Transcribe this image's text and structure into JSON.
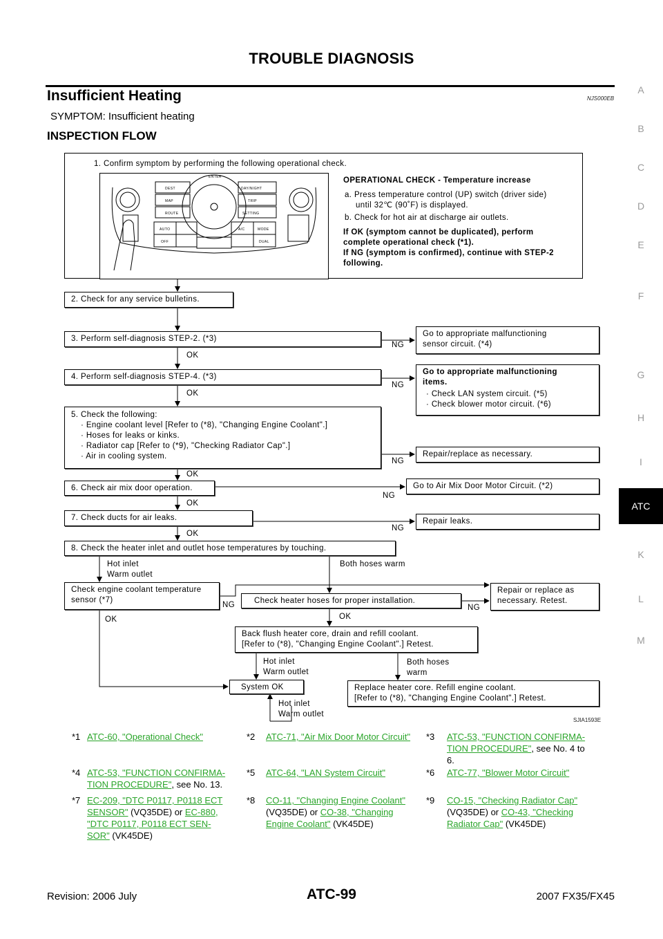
{
  "header": {
    "title": "TROUBLE DIAGNOSIS"
  },
  "section": {
    "title": "Insufficient Heating",
    "code": "NJS000EB",
    "symptom": "SYMPTOM: Insufficient heating",
    "subheading": "INSPECTION FLOW"
  },
  "side_index": {
    "items": [
      "A",
      "B",
      "C",
      "D",
      "E",
      "F",
      "G",
      "H",
      "I",
      "ATC",
      "K",
      "L",
      "M"
    ],
    "active": "ATC"
  },
  "flow": {
    "step1": {
      "title": "1. Confirm symptom by performing the following operational check.",
      "check_title": "OPERATIONAL CHECK - Temperature increase",
      "a_line1": "a. Press temperature control (UP) switch (driver side)",
      "a_line2": "until 32℃  (90˚F) is displayed.",
      "b": "b. Check for hot air at discharge air outlets.",
      "result1": "If OK (symptom cannot be duplicated), perform",
      "result2": "complete operational check (*1).",
      "result3": "If NG (symptom is confirmed), continue with STEP-2",
      "result4": "following.",
      "panel": {
        "buttons": [
          "DEST",
          "MAP",
          "ROUTE",
          "DAY/NIGHT",
          "TRIP",
          "SETTING",
          "AUTO",
          "OFF",
          "A/C",
          "MODE",
          "DUAL",
          "ENTER"
        ]
      }
    },
    "step2": "2. Check for any service bulletins.",
    "step3": "3. Perform self-diagnosis STEP-2. (*3)",
    "step3_ng": [
      "Go to appropriate malfunctioning",
      "sensor circuit. (*4)"
    ],
    "step4": "4. Perform self-diagnosis STEP-4. (*3)",
    "step4_ng_title": [
      "Go to appropriate malfunctioning",
      "items."
    ],
    "step4_ng_items": [
      "· Check LAN system circuit. (*5)",
      "· Check blower motor circuit. (*6)"
    ],
    "step5_title": "5.  Check the following:",
    "step5_items": [
      "· Engine coolant level [Refer to (*8), \"Changing Engine Coolant\".]",
      "· Hoses for leaks or kinks.",
      "· Radiator cap [Refer to (*9), \"Checking Radiator Cap\".]",
      "· Air in cooling system."
    ],
    "step5_ng": "Repair/replace as necessary.",
    "step6": "6. Check air mix door operation.",
    "step6_ng": "Go to Air Mix Door Motor Circuit. (*2)",
    "step7": "7. Check ducts for air leaks.",
    "step7_ng": "Repair leaks.",
    "step8": "8. Check the heater inlet and outlet hose temperatures by touching.",
    "hot_inlet": "Hot inlet",
    "warm_outlet": "Warm outlet",
    "both_warm": "Both hoses warm",
    "both_hoses": "Both hoses",
    "warm": "warm",
    "ect_sensor": [
      "Check engine coolant temperature",
      "sensor (*7)"
    ],
    "heater_hoses": "Check heater hoses for proper installation.",
    "repair_replace": [
      "Repair or replace as",
      "necessary. Retest."
    ],
    "back_flush": [
      "Back flush heater core, drain and refill coolant.",
      "[Refer to (*8), \"Changing Engine Coolant\".] Retest."
    ],
    "system_ok": "System OK",
    "replace_core": [
      "Replace heater core. Refill engine coolant.",
      "[Refer to (*8), \"Changing Engine Coolant\".] Retest."
    ],
    "ok": "OK",
    "ng": "NG",
    "figure_id": "SJIA1593E"
  },
  "references": [
    {
      "num": "*1",
      "link": "ATC-60, \"Operational Check\"",
      "after": ""
    },
    {
      "num": "*2",
      "link": "ATC-71, \"Air Mix Door Motor Circuit\"",
      "after": ""
    },
    {
      "num": "*3",
      "link1": "ATC-53, \"FUNCTION CONFIRMA-",
      "link2": "TION PROCEDURE\"",
      "after": ", see No. 4 to",
      "after2": "6."
    },
    {
      "num": "*4",
      "link1": "ATC-53, \"FUNCTION CONFIRMA-",
      "link2": "TION PROCEDURE\"",
      "after": ", see No. 13."
    },
    {
      "num": "*5",
      "link": "ATC-64, \"LAN System Circuit\"",
      "after": ""
    },
    {
      "num": "*6",
      "link": "ATC-77, \"Blower Motor Circuit\"",
      "after": ""
    },
    {
      "num": "*7",
      "link1": "EC-209, \"DTC P0117, P0118 ECT ",
      "link2": "SENSOR\"",
      "mid": " (VQ35DE) or ",
      "link3": "EC-880, ",
      "link4": "\"DTC P0117, P0118 ECT SEN-",
      "link5": "SOR\"",
      "after": "  (VK45DE)"
    },
    {
      "num": "*8",
      "link1": "CO-11, \"Changing Engine Coolant\"",
      "mid": "(VQ35DE) or ",
      "link2": "CO-38, \"Changing ",
      "link3": "Engine Coolant\"",
      "after": "  (VK45DE)"
    },
    {
      "num": "*9",
      "link1": "CO-15, \"Checking Radiator Cap\"",
      "mid": "(VQ35DE) or ",
      "link2": "CO-43, \"Checking ",
      "link3": "Radiator Cap\"",
      "after": "  (VK45DE)"
    }
  ],
  "footer": {
    "revision": "Revision: 2006 July",
    "page": "ATC-99",
    "model": "2007 FX35/FX45"
  },
  "colors": {
    "link": "#2aa52a",
    "active_tab_bg": "#000000",
    "side_index_text": "#9a9a9a"
  }
}
